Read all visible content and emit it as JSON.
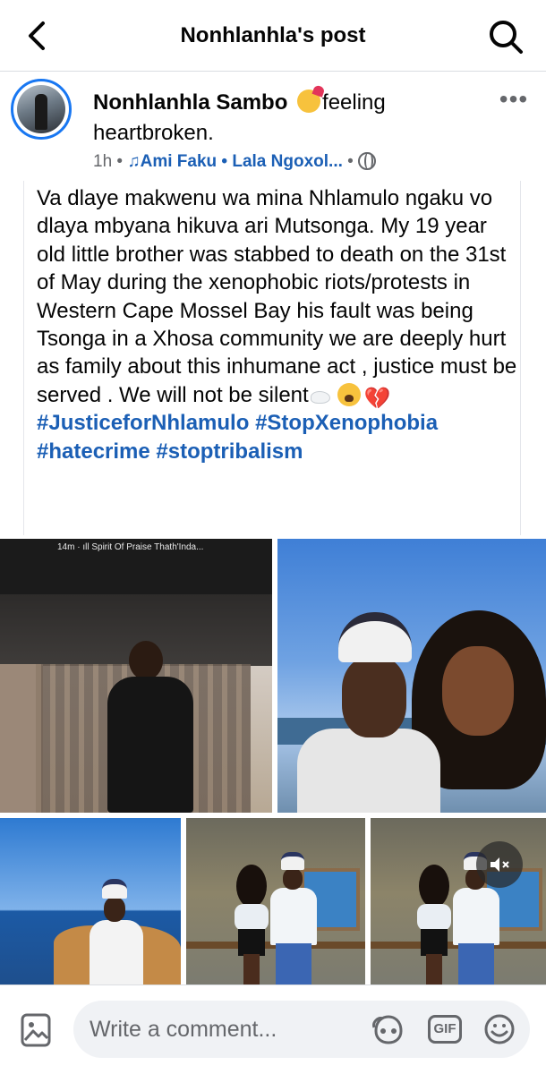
{
  "header": {
    "title": "Nonhlanhla's post"
  },
  "post": {
    "author": "Nonhlanhla Sambo",
    "feeling": "feeling heartbroken.",
    "time": "1h",
    "separator": "•",
    "music_artist": "Ami Faku",
    "music_title": "Lala Ngoxol...",
    "body_text": "Va dlaye makwenu wa mina Nhlamulo ngaku vo dlaya mbyana hikuva ari Mutsonga. My 19 year old little brother was stabbed to death on the 31st of May during the xenophobic riots/protests in Western Cape Mossel Bay his fault was being Tsonga in a Xhosa community we are deeply hurt as family about this inhumane act , justice must be served . We will not be silent",
    "hashtags": [
      "#JusticeforNhlamulo",
      "#StopXenophobia",
      "#hatecrime",
      "#stoptribalism"
    ]
  },
  "photos": {
    "first_overlay_text": "14m · ıll Spirit Of Praise Thath'Inda..."
  },
  "comment_bar": {
    "placeholder": "Write a comment...",
    "gif_label": "GIF"
  },
  "colors": {
    "accent": "#1877f2",
    "hashtag": "#1b5fb5",
    "secondary_text": "#65676b",
    "input_bg": "#f0f2f5"
  },
  "icons": {
    "back": "chevron-left-icon",
    "search": "search-icon",
    "more": "more-horizontal-icon",
    "privacy": "globe-icon",
    "music": "music-note-icon",
    "photo": "photo-icon",
    "avatar_sticker": "avatar-sticker-icon",
    "gif": "gif-icon",
    "emoji": "emoji-icon",
    "mute": "speaker-muted-icon"
  }
}
